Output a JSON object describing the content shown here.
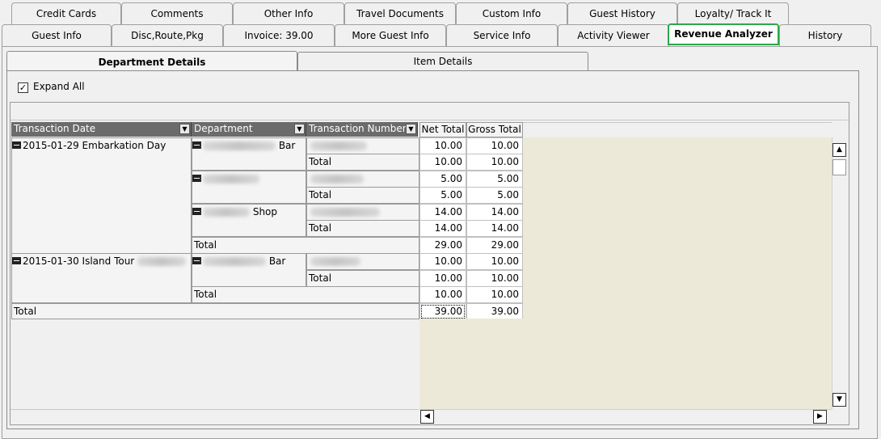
{
  "tabs_row1": [
    {
      "label": "Credit Cards"
    },
    {
      "label": "Comments"
    },
    {
      "label": "Other Info"
    },
    {
      "label": "Travel Documents"
    },
    {
      "label": "Custom Info"
    },
    {
      "label": "Guest History"
    },
    {
      "label": "Loyalty/ Track It"
    }
  ],
  "tabs_row2": [
    {
      "label": "Guest Info"
    },
    {
      "label": "Disc,Route,Pkg"
    },
    {
      "label": "Invoice: 39.00"
    },
    {
      "label": "More Guest Info"
    },
    {
      "label": "Service Info"
    },
    {
      "label": "Activity Viewer"
    },
    {
      "label": "Revenue Analyzer",
      "active": true
    },
    {
      "label": "History"
    }
  ],
  "subtabs": {
    "department": "Department Details",
    "item": "Item Details"
  },
  "expand_all": {
    "label": "Expand All",
    "checked": true,
    "check_glyph": "✓"
  },
  "columns": {
    "transaction_date": "Transaction Date",
    "department": "Department",
    "transaction_number": "Transaction Number",
    "net_total": "Net Total",
    "gross_total": "Gross Total",
    "dropdown_glyph": "▼"
  },
  "groups": {
    "day1": "2015-01-29 Embarkation Day",
    "day2": "2015-01-30 Island Tour",
    "dept_bar_suffix": "Bar",
    "dept_shop_suffix": "Shop"
  },
  "labels": {
    "total": "Total"
  },
  "values": {
    "r1": {
      "net": "10.00",
      "gross": "10.00"
    },
    "r2": {
      "net": "10.00",
      "gross": "10.00"
    },
    "r3": {
      "net": "5.00",
      "gross": "5.00"
    },
    "r4": {
      "net": "5.00",
      "gross": "5.00"
    },
    "r5": {
      "net": "14.00",
      "gross": "14.00"
    },
    "r6": {
      "net": "14.00",
      "gross": "14.00"
    },
    "r7": {
      "net": "29.00",
      "gross": "29.00"
    },
    "r8": {
      "net": "10.00",
      "gross": "10.00"
    },
    "r9": {
      "net": "10.00",
      "gross": "10.00"
    },
    "r10": {
      "net": "10.00",
      "gross": "10.00"
    },
    "r11": {
      "net": "39.00",
      "gross": "39.00"
    }
  },
  "scroll": {
    "up": "▲",
    "down": "▼",
    "left": "◀",
    "right": "▶"
  },
  "colors": {
    "active_tab_border": "#2aa84a",
    "header_bg": "#6b6b6b",
    "data_bg": "#ece9d8"
  }
}
